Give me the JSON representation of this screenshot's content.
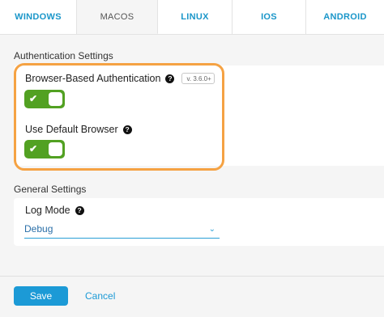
{
  "tabs": [
    {
      "label": "WINDOWS",
      "active": false
    },
    {
      "label": "MACOS",
      "active": true
    },
    {
      "label": "LINUX",
      "active": false
    },
    {
      "label": "IOS",
      "active": false
    },
    {
      "label": "ANDROID",
      "active": false
    }
  ],
  "auth_settings": {
    "title": "Authentication Settings",
    "browser_auth": {
      "label": "Browser-Based Authentication",
      "badge": "v. 3.6.0+",
      "enabled": true
    },
    "default_browser": {
      "label": "Use Default Browser",
      "enabled": true
    }
  },
  "general_settings": {
    "title": "General Settings",
    "log_mode": {
      "label": "Log Mode",
      "value": "Debug"
    }
  },
  "actions": {
    "save": "Save",
    "cancel": "Cancel"
  },
  "colors": {
    "accent": "#1c9ad6",
    "toggle_on": "#52a122",
    "highlight": "#f5a243"
  },
  "icons": {
    "help": "question-circle-icon",
    "apple": "apple-icon",
    "check": "check-icon",
    "chevron": "chevron-down-icon"
  }
}
